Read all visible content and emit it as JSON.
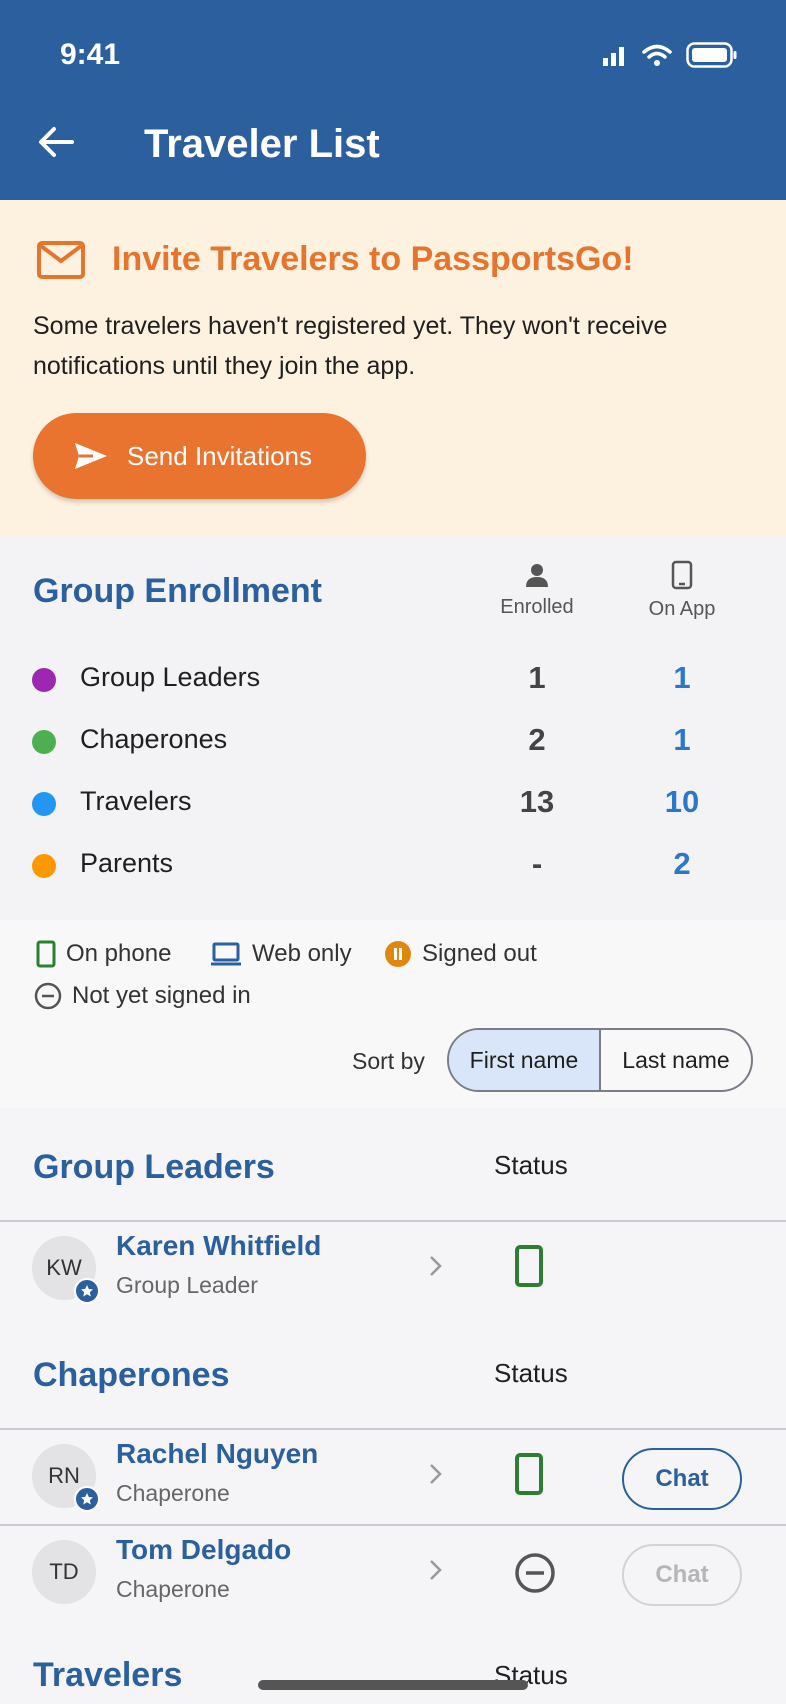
{
  "status_bar": {
    "time": "9:41"
  },
  "header": {
    "title": "Traveler List"
  },
  "invite": {
    "title": "Invite Travelers to PassportsGo!",
    "text": "Some travelers haven't registered yet. They won't receive notifications until they join the app.",
    "button_label": "Send Invitations"
  },
  "enrollment": {
    "title": "Group Enrollment",
    "col_enrolled": "Enrolled",
    "col_on_app": "On App",
    "rows": [
      {
        "label": "Group Leaders",
        "enrolled": "1",
        "on_app": "1",
        "color": "#9c27b0"
      },
      {
        "label": "Chaperones",
        "enrolled": "2",
        "on_app": "1",
        "color": "#4caf50"
      },
      {
        "label": "Travelers",
        "enrolled": "13",
        "on_app": "10",
        "color": "#2196f3"
      },
      {
        "label": "Parents",
        "enrolled": "-",
        "on_app": "2",
        "color": "#ff9800"
      }
    ]
  },
  "legend": {
    "on_phone": "On phone",
    "web_only": "Web only",
    "signed_out": "Signed out",
    "not_signed_in": "Not yet signed in"
  },
  "sort": {
    "label": "Sort by",
    "first": "First name",
    "last": "Last name",
    "active": "first"
  },
  "sections": {
    "group_leaders": {
      "title": "Group Leaders",
      "status_label": "Status",
      "people": [
        {
          "initials": "KW",
          "name": "Karen Whitfield",
          "role": "Group Leader",
          "status": "on-phone"
        }
      ]
    },
    "chaperones": {
      "title": "Chaperones",
      "status_label": "Status",
      "people": [
        {
          "initials": "RN",
          "name": "Rachel Nguyen",
          "role": "Chaperone",
          "status": "on-phone",
          "chat": "Chat"
        },
        {
          "initials": "TD",
          "name": "Tom Delgado",
          "role": "Chaperone",
          "status": "not-signed-in",
          "chat": "Chat"
        }
      ]
    },
    "travelers": {
      "title": "Travelers",
      "status_label": "Status"
    }
  },
  "colors": {
    "brand": "#2b5f9e",
    "accent": "#e8742f",
    "phone_green": "#2e7d32",
    "signed_out": "#e0870f"
  }
}
